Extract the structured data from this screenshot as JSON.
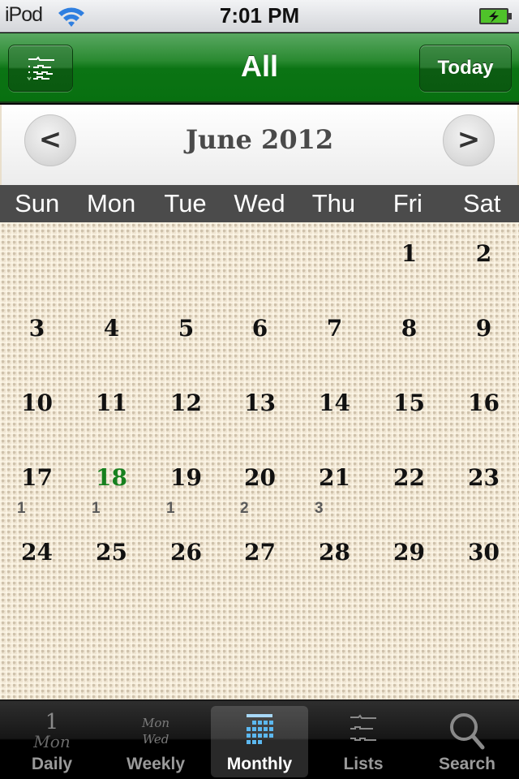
{
  "status_bar": {
    "carrier": "iPod",
    "time": "7:01 PM",
    "wifi_icon": "wifi-icon",
    "battery_icon": "battery-charging-icon",
    "battery_color": "#3cb81e"
  },
  "nav_bar": {
    "title": "All",
    "menu_icon": "list-icon",
    "today_label": "Today",
    "accent": "#0b7414"
  },
  "month_header": {
    "title": "June 2012",
    "prev_label": "<",
    "next_label": ">"
  },
  "weekdays": [
    "Sun",
    "Mon",
    "Tue",
    "Wed",
    "Thu",
    "Fri",
    "Sat"
  ],
  "calendar": {
    "today": 18,
    "today_color": "#16801e",
    "weeks": [
      [
        {
          "day": ""
        },
        {
          "day": ""
        },
        {
          "day": ""
        },
        {
          "day": ""
        },
        {
          "day": ""
        },
        {
          "day": "1"
        },
        {
          "day": "2"
        }
      ],
      [
        {
          "day": "3"
        },
        {
          "day": "4"
        },
        {
          "day": "5"
        },
        {
          "day": "6"
        },
        {
          "day": "7"
        },
        {
          "day": "8"
        },
        {
          "day": "9"
        }
      ],
      [
        {
          "day": "10"
        },
        {
          "day": "11"
        },
        {
          "day": "12"
        },
        {
          "day": "13"
        },
        {
          "day": "14"
        },
        {
          "day": "15"
        },
        {
          "day": "16"
        }
      ],
      [
        {
          "day": "17",
          "count": "1"
        },
        {
          "day": "18",
          "count": "1",
          "today": true
        },
        {
          "day": "19",
          "count": "1"
        },
        {
          "day": "20",
          "count": "2"
        },
        {
          "day": "21",
          "count": "3"
        },
        {
          "day": "22"
        },
        {
          "day": "23"
        }
      ],
      [
        {
          "day": "24"
        },
        {
          "day": "25"
        },
        {
          "day": "26"
        },
        {
          "day": "27"
        },
        {
          "day": "28"
        },
        {
          "day": "29"
        },
        {
          "day": "30"
        }
      ]
    ]
  },
  "tab_bar": {
    "tabs": [
      {
        "label": "Daily",
        "icon": "daily-icon",
        "active": false
      },
      {
        "label": "Weekly",
        "icon": "weekly-icon",
        "active": false
      },
      {
        "label": "Monthly",
        "icon": "calendar-grid-icon",
        "active": true
      },
      {
        "label": "Lists",
        "icon": "list-icon",
        "active": false
      },
      {
        "label": "Search",
        "icon": "search-icon",
        "active": false
      }
    ],
    "daily_icon_text": {
      "top": "1",
      "bottom": "Mon"
    },
    "weekly_icon_text": {
      "top": "Mon",
      "bottom": "Wed"
    },
    "active_icon_color": "#5cb8f0"
  }
}
